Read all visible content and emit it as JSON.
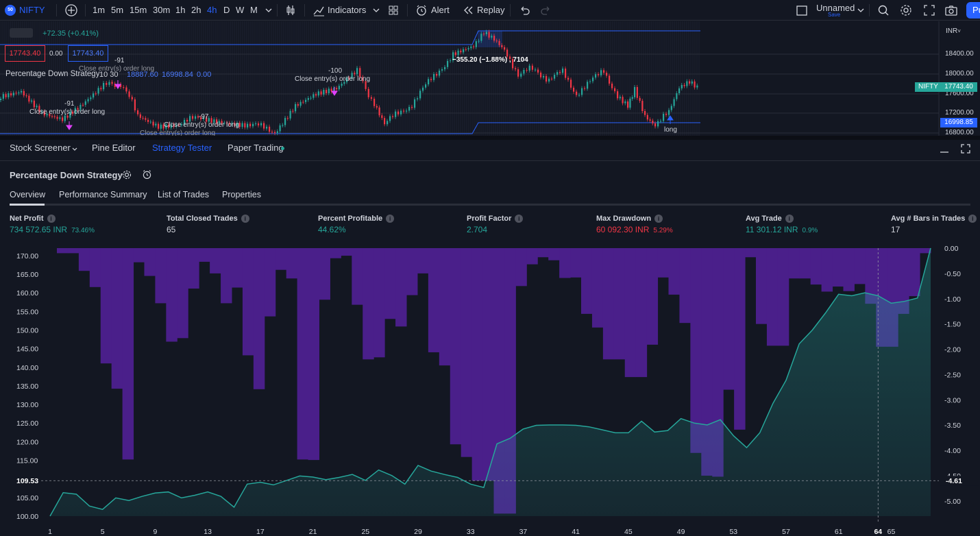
{
  "toolbar": {
    "symbol_badge": "50",
    "symbol": "NIFTY",
    "intervals": [
      "1m",
      "5m",
      "15m",
      "30m",
      "1h",
      "2h",
      "4h",
      "D",
      "W",
      "M"
    ],
    "active_interval": "4h",
    "indicators_label": "Indicators",
    "alert_label": "Alert",
    "replay_label": "Replay",
    "layout_name": "Unnamed",
    "layout_save": "Save",
    "publish_label": "Pu"
  },
  "price_chart": {
    "change_text": "+72.35 (+0.41%)",
    "bid": "17743.40",
    "spread": "0.00",
    "ask": "17743.40",
    "strategy_legend": "Percentage Down Strategy",
    "strategy_params": "10 30",
    "strategy_values": [
      "18887.60",
      "16998.84",
      "0.00"
    ],
    "currency": "INR",
    "price_ticks": [
      "18400.00",
      "18000.00",
      "17600.00",
      "17200.00",
      "16800.00"
    ],
    "symbol_tag": "NIFTY",
    "last_price": "17743.40",
    "stop_price": "16998.85",
    "measure_label": "−355.20 (−1.88%) , 7104",
    "annotations": [
      {
        "text": "-91",
        "kind": "qty"
      },
      {
        "text": "Close entry(s) order long",
        "kind": "label"
      },
      {
        "text": "-91",
        "kind": "qty"
      },
      {
        "text": "Close entry(s) order long",
        "kind": "label"
      },
      {
        "text": "-100",
        "kind": "qty"
      },
      {
        "text": "Close entry(s) order long",
        "kind": "label"
      },
      {
        "text": "-97",
        "kind": "qty"
      },
      {
        "text": "Close entry(s) order long",
        "kind": "label"
      },
      {
        "text": "Close entry(s) order long",
        "kind": "label"
      },
      {
        "text": "long",
        "kind": "label"
      }
    ]
  },
  "bottom_tabs": {
    "stock_screener": "Stock Screener",
    "pine_editor": "Pine Editor",
    "strategy_tester": "Strategy Tester",
    "paper_trading": "Paper Trading"
  },
  "strategy": {
    "title": "Percentage Down Strategy",
    "subtabs": [
      "Overview",
      "Performance Summary",
      "List of Trades",
      "Properties"
    ],
    "active_subtab": "Overview"
  },
  "metrics": {
    "net_profit": {
      "label": "Net Profit",
      "value": "734 572.65 INR",
      "pct": "73.46%"
    },
    "total_closed_trades": {
      "label": "Total Closed Trades",
      "value": "65"
    },
    "percent_profitable": {
      "label": "Percent Profitable",
      "value": "44.62%"
    },
    "profit_factor": {
      "label": "Profit Factor",
      "value": "2.704"
    },
    "max_drawdown": {
      "label": "Max Drawdown",
      "value": "60 092.30 INR",
      "pct": "5.29%"
    },
    "avg_trade": {
      "label": "Avg Trade",
      "value": "11 301.12 INR",
      "pct": "0.9%"
    },
    "avg_bars": {
      "label": "Avg # Bars in Trades",
      "value": "17"
    }
  },
  "chart_data": {
    "type": "area",
    "left_axis_ticks": [
      "170.00",
      "165.00",
      "160.00",
      "155.00",
      "150.00",
      "145.00",
      "140.00",
      "135.00",
      "130.00",
      "125.00",
      "120.00",
      "115.00",
      "109.53",
      "105.00",
      "100.00"
    ],
    "right_axis_ticks": [
      "0.00",
      "-0.50",
      "-1.00",
      "-1.50",
      "-2.00",
      "-2.50",
      "-3.00",
      "-3.50",
      "-4.00",
      "-4.50",
      "-5.00"
    ],
    "crosshair_left": "109.53",
    "crosshair_right": "-4.61",
    "x_ticks": [
      "1",
      "5",
      "9",
      "13",
      "17",
      "21",
      "25",
      "29",
      "33",
      "37",
      "41",
      "45",
      "49",
      "53",
      "57",
      "61",
      "64",
      "65"
    ],
    "left_ylim": [
      100,
      172
    ],
    "right_ylim": [
      -5.3,
      0
    ],
    "series": [
      {
        "name": "equity",
        "color": "#26a69a",
        "values": [
          100,
          106.3,
          105.9,
          102.7,
          101.8,
          104.9,
          104.2,
          105.3,
          106.2,
          106.5,
          104.9,
          105.6,
          106.5,
          105.3,
          102.4,
          108.6,
          109.1,
          108.4,
          109.6,
          110.8,
          110.5,
          109.8,
          110.4,
          111.2,
          109.6,
          112.4,
          110.9,
          108.6,
          113.6,
          112.1,
          111.2,
          110.4,
          108.6,
          107.7,
          119.4,
          120.9,
          123.4,
          124.4,
          124.5,
          124.5,
          124.4,
          124.0,
          123.2,
          122.4,
          122.4,
          125.5,
          122.6,
          123.0,
          126.2,
          125.0,
          124.5,
          125.9,
          121.6,
          118.4,
          122.4,
          130.3,
          136.5,
          146.3,
          150.0,
          154.6,
          159.6,
          159.2,
          160.0,
          159.2,
          157.2,
          157.7,
          158.6,
          172.0
        ]
      },
      {
        "name": "drawdown",
        "color": "#5b2a9e",
        "values": [
          -0.1,
          -0.1,
          -0.45,
          -0.77,
          -2.28,
          -2.78,
          -4.18,
          -0.28,
          -0.55,
          -1.09,
          -1.85,
          -1.78,
          -0.8,
          -0.27,
          -0.5,
          -1.09,
          -0.78,
          -2.12,
          -2.79,
          -1.35,
          -0.43,
          -0.6,
          -4.18,
          -4.19,
          -1.02,
          -0.2,
          -0.15,
          -1.12,
          -2.2,
          -2.16,
          -1.4,
          -1.55,
          -0.93,
          -0.5,
          -2.06,
          -2.32,
          -3.88,
          -4.13,
          -4.6,
          -4.6,
          -5.25,
          -5.25,
          -0.75,
          -0.32,
          -0.18,
          -0.24,
          -0.59,
          -0.58,
          -1.3,
          -1.57,
          -2.2,
          -2.2,
          -2.55,
          -2.55,
          -1.91,
          -0.58,
          -0.92,
          -1.48,
          -4.05,
          -4.5,
          -4.52,
          -2.8,
          -3.59,
          -0.18,
          -1.5,
          -1.93,
          -1.93,
          -0.6,
          -0.6,
          -0.72,
          -0.86,
          -0.76,
          -0.85,
          -0.71,
          -1.1,
          -1.95,
          -1.95,
          -1.3,
          -0.95,
          -0.1
        ]
      }
    ]
  }
}
